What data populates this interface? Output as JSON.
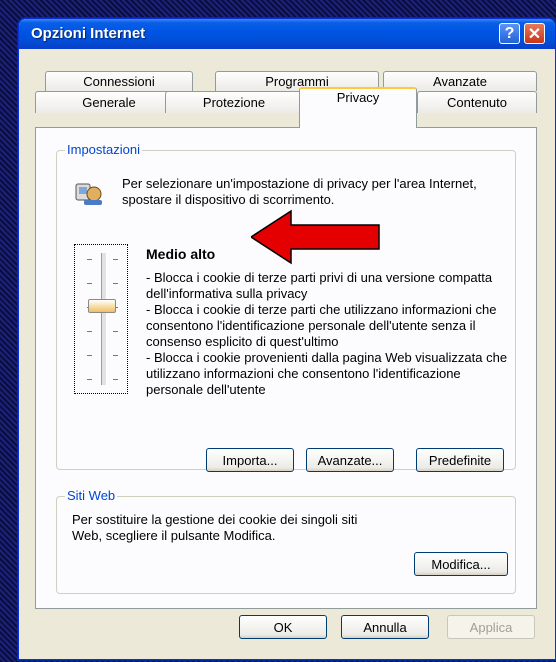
{
  "window": {
    "title": "Opzioni Internet"
  },
  "tabs": {
    "back_row": [
      "Connessioni",
      "Programmi",
      "Avanzate"
    ],
    "front_row": [
      "Generale",
      "Protezione",
      "Privacy",
      "Contenuto"
    ],
    "active": "Privacy"
  },
  "impostazioni": {
    "group_label": "Impostazioni",
    "intro": "Per selezionare un'impostazione di privacy per l'area Internet, spostare il dispositivo di scorrimento.",
    "level_title": "Medio alto",
    "level_description": "- Blocca i cookie di terze parti privi di una versione compatta dell'informativa sulla privacy\n- Blocca i cookie di terze parti che utilizzano informazioni che consentono l'identificazione personale dell'utente senza il consenso esplicito di quest'ultimo\n- Blocca i cookie provenienti dalla pagina Web visualizzata che utilizzano informazioni che consentono l'identificazione personale dell'utente",
    "buttons": {
      "importa": "Importa...",
      "avanzate": "Avanzate...",
      "predefinite": "Predefinite"
    },
    "slider_level": 4,
    "slider_levels": 6
  },
  "siti_web": {
    "group_label": "Siti Web",
    "text": "Per sostituire la gestione dei cookie dei singoli siti Web, scegliere il pulsante Modifica.",
    "button": "Modifica..."
  },
  "footer": {
    "ok": "OK",
    "cancel": "Annulla",
    "apply": "Applica"
  },
  "colors": {
    "titlebar": "#0055e5",
    "group_label": "#0046d5",
    "arrow": "#e40000",
    "tab_highlight": "#ffc83c"
  }
}
